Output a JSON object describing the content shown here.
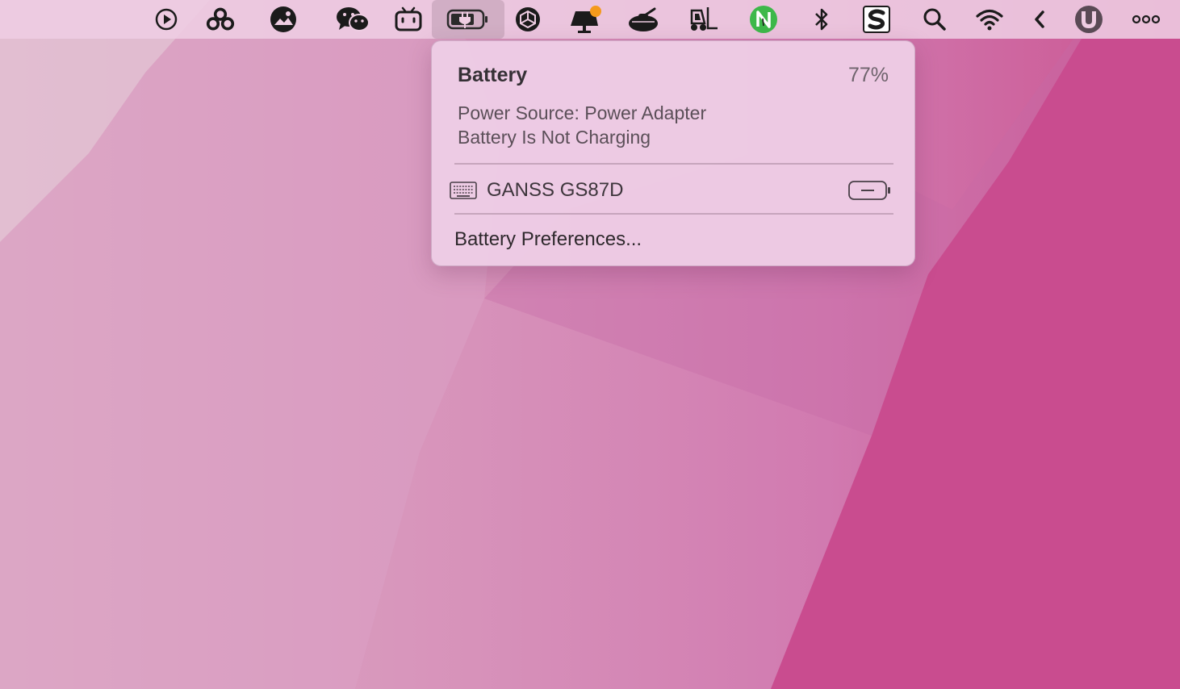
{
  "menubar": {
    "icons": [
      {
        "name": "play-circle-icon"
      },
      {
        "name": "cloud-rings-icon"
      },
      {
        "name": "image-viewer-icon"
      },
      {
        "name": "wechat-icon"
      },
      {
        "name": "bilibili-tv-icon"
      },
      {
        "name": "battery-charging-icon"
      },
      {
        "name": "unity-cube-icon"
      },
      {
        "name": "notification-monitor-icon"
      },
      {
        "name": "tank-icon"
      },
      {
        "name": "forklift-icon"
      },
      {
        "name": "n-app-icon"
      },
      {
        "name": "bluetooth-icon"
      },
      {
        "name": "s-app-icon"
      },
      {
        "name": "search-icon"
      },
      {
        "name": "wifi-icon"
      },
      {
        "name": "chevron-left-icon"
      },
      {
        "name": "shield-u-icon"
      },
      {
        "name": "more-dots-icon"
      }
    ]
  },
  "battery_menu": {
    "title": "Battery",
    "percent": "77%",
    "power_source": "Power Source: Power Adapter",
    "charging_status": "Battery Is Not Charging",
    "device": {
      "name": "GANSS  GS87D",
      "icon": "keyboard-icon"
    },
    "preferences_label": "Battery Preferences..."
  },
  "colors": {
    "accent_green": "#3db84a",
    "notification_orange": "#f49a1c"
  }
}
